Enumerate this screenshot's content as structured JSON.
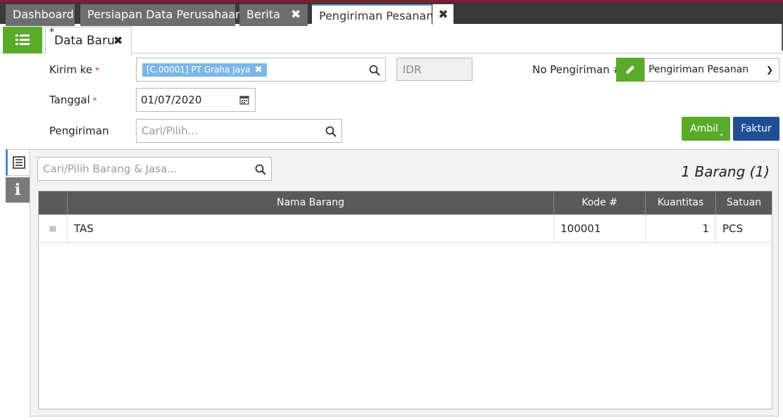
{
  "top_tabs": [
    {
      "label": "Dashboard"
    },
    {
      "label": "Persiapan Data Perusahaan"
    },
    {
      "label": "Berita"
    },
    {
      "label": "Pengiriman Pesanan"
    }
  ],
  "doc_tab": {
    "modified_marker": "*",
    "label": "Data Baru"
  },
  "form": {
    "kirim_ke": {
      "label": "Kirim ke",
      "required": "*",
      "chip": "[C.00001] PT Graha Jaya"
    },
    "currency": "IDR",
    "tanggal": {
      "label": "Tanggal",
      "required": "*",
      "value": "01/07/2020"
    },
    "pengiriman": {
      "label": "Pengiriman",
      "placeholder": "Cari/Pilih..."
    },
    "no_pengiriman": {
      "label": "No Pengiriman #",
      "selected": "Pengiriman Pesanan"
    }
  },
  "buttons": {
    "ambil": "Ambil",
    "faktur": "Faktur"
  },
  "items": {
    "search_placeholder": "Cari/Pilih Barang & Jasa...",
    "count": "1 Barang (1)",
    "columns": [
      "Nama Barang",
      "Kode #",
      "Kuantitas",
      "Satuan"
    ],
    "rows": [
      {
        "nama": "TAS",
        "kode": "100001",
        "qty": "1",
        "satuan": "PCS"
      }
    ]
  },
  "colors": {
    "accent_green": "#5aaa2a",
    "accent_blue": "#1f4e96",
    "chip_blue": "#7cb6e8",
    "brand_red": "#8b1a2e"
  },
  "icons": [
    "list-menu-icon",
    "search-icon",
    "calendar-icon",
    "pencil-icon",
    "chevron-down-icon",
    "close-icon",
    "document-lines-icon",
    "info-icon",
    "drag-handle-icon"
  ]
}
